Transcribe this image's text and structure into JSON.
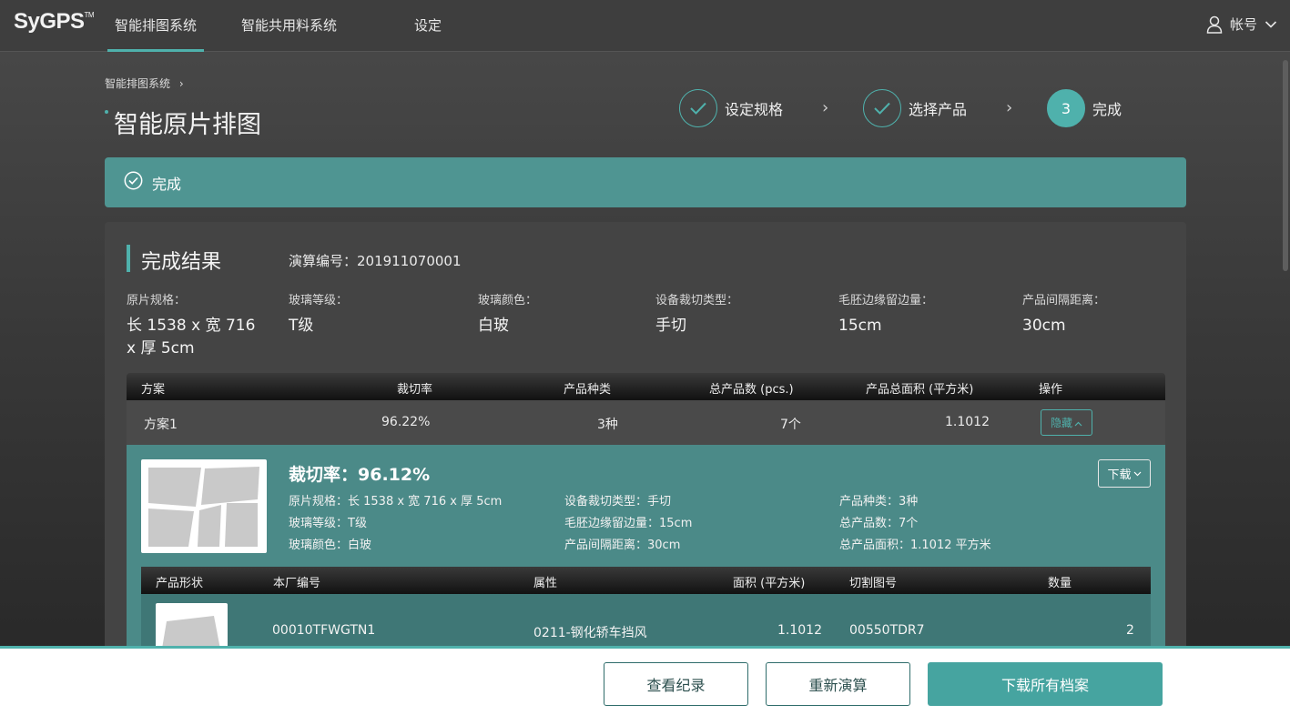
{
  "app": {
    "logo": "SyGPS",
    "logo_mark": "TM",
    "nav": [
      "智能排图系统",
      "智能共用料系统",
      "设定"
    ],
    "account": "帐号"
  },
  "header": {
    "breadcrumb": "智能排图系统",
    "title": "智能原片排图",
    "steps": [
      {
        "label": "设定规格",
        "state": "done"
      },
      {
        "label": "选择产品",
        "state": "done"
      },
      {
        "label": "完成",
        "state": "current",
        "number": "3"
      }
    ]
  },
  "banner": {
    "text": "完成"
  },
  "result": {
    "title": "完成结果",
    "calc_no": "演算编号：201911070001",
    "specs": [
      {
        "label": "原片规格：",
        "value_line1": "长 1538 x 宽 716",
        "value_line2": "x 厚 5cm"
      },
      {
        "label": "玻璃等级：",
        "value_line1": "T级"
      },
      {
        "label": "玻璃颜色：",
        "value_line1": "白玻"
      },
      {
        "label": "设备裁切类型：",
        "value_line1": "手切"
      },
      {
        "label": "毛胚边缘留边量：",
        "value_line1": "15cm"
      },
      {
        "label": "产品间隔距离：",
        "value_line1": "30cm"
      }
    ]
  },
  "plan_table": {
    "headers": [
      "方案",
      "裁切率",
      "产品种类",
      "总产品数 (pcs.)",
      "产品总面积 (平方米)",
      "操作"
    ],
    "row": [
      "方案1",
      "96.22%",
      "3种",
      "7个",
      "1.1012"
    ],
    "hide_label": "隐藏"
  },
  "detail": {
    "rate": "裁切率：96.12%",
    "download_label": "下载",
    "info": [
      "原片规格：长 1538 x 宽 716 x 厚 5cm",
      "玻璃等级：T级",
      "玻璃颜色：白玻",
      "设备裁切类型：手切",
      "毛胚边缘留边量：15cm",
      "产品间隔距离：30cm",
      "产品种类：3种",
      "总产品数：7个",
      "总产品面积：1.1012 平方米"
    ]
  },
  "product_table": {
    "headers": [
      "产品形状",
      "本厂编号",
      "属性",
      "面积 (平方米)",
      "切割图号",
      "数量"
    ],
    "row": [
      "00010TFWGTN1",
      "0211-钢化轿车挡风",
      "1.1012",
      "00550TDR7",
      "2"
    ]
  },
  "footer": {
    "view_records": "查看纪录",
    "recalculate": "重新演算",
    "download_all": "下载所有档案"
  },
  "colors": {
    "accent": "#4fb1ac",
    "banner": "#4f9592",
    "detail_bg": "#4b8a88"
  }
}
